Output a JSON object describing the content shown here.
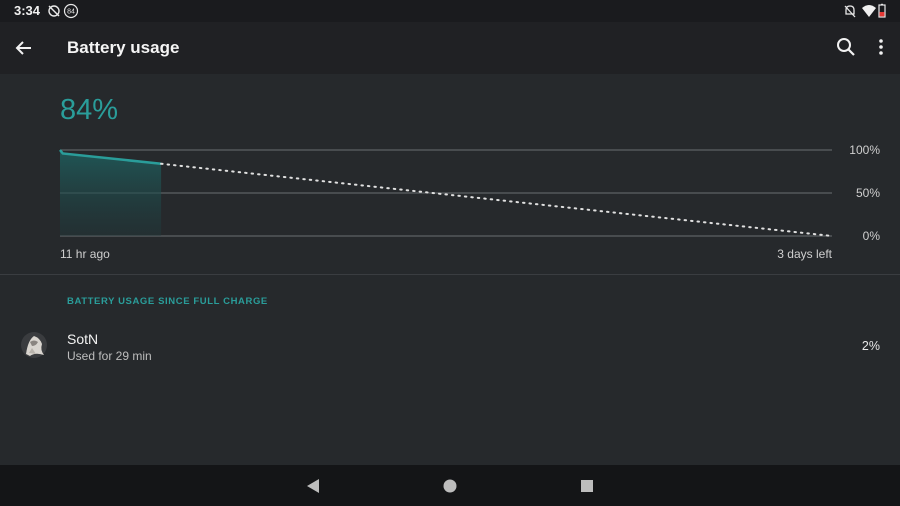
{
  "status_bar": {
    "time": "3:34",
    "badge": "84",
    "icons": [
      "sync-off-icon",
      "badge-84-icon",
      "notifications-off-icon",
      "wifi-icon",
      "battery-low-icon"
    ]
  },
  "app_bar": {
    "title": "Battery usage",
    "back_icon": "arrow-back-icon",
    "search_icon": "search-icon",
    "more_icon": "more-vert-icon"
  },
  "battery": {
    "percent_label": "84%"
  },
  "chart_data": {
    "type": "line",
    "x_labels": {
      "start": "11 hr ago",
      "end": "3 days left"
    },
    "y_ticks": [
      "100%",
      "50%",
      "0%"
    ],
    "ylim": [
      0,
      100
    ],
    "series": [
      {
        "style": "solid",
        "points": [
          [
            0,
            100
          ],
          [
            0.3,
            96
          ],
          [
            11,
            84
          ]
        ]
      },
      {
        "style": "dotted",
        "points": [
          [
            11,
            84
          ],
          [
            84,
            0
          ]
        ]
      }
    ],
    "grid": true
  },
  "usage": {
    "section_title": "BATTERY USAGE SINCE FULL CHARGE",
    "items": [
      {
        "name": "SotN",
        "detail": "Used for 29 min",
        "percent": "2%"
      }
    ]
  },
  "nav_bar": {
    "buttons": [
      "back-triangle-icon",
      "home-circle-icon",
      "overview-square-icon"
    ]
  },
  "colors": {
    "accent": "#2a9d9a",
    "background": "#26292c",
    "toolbar": "#202124"
  }
}
